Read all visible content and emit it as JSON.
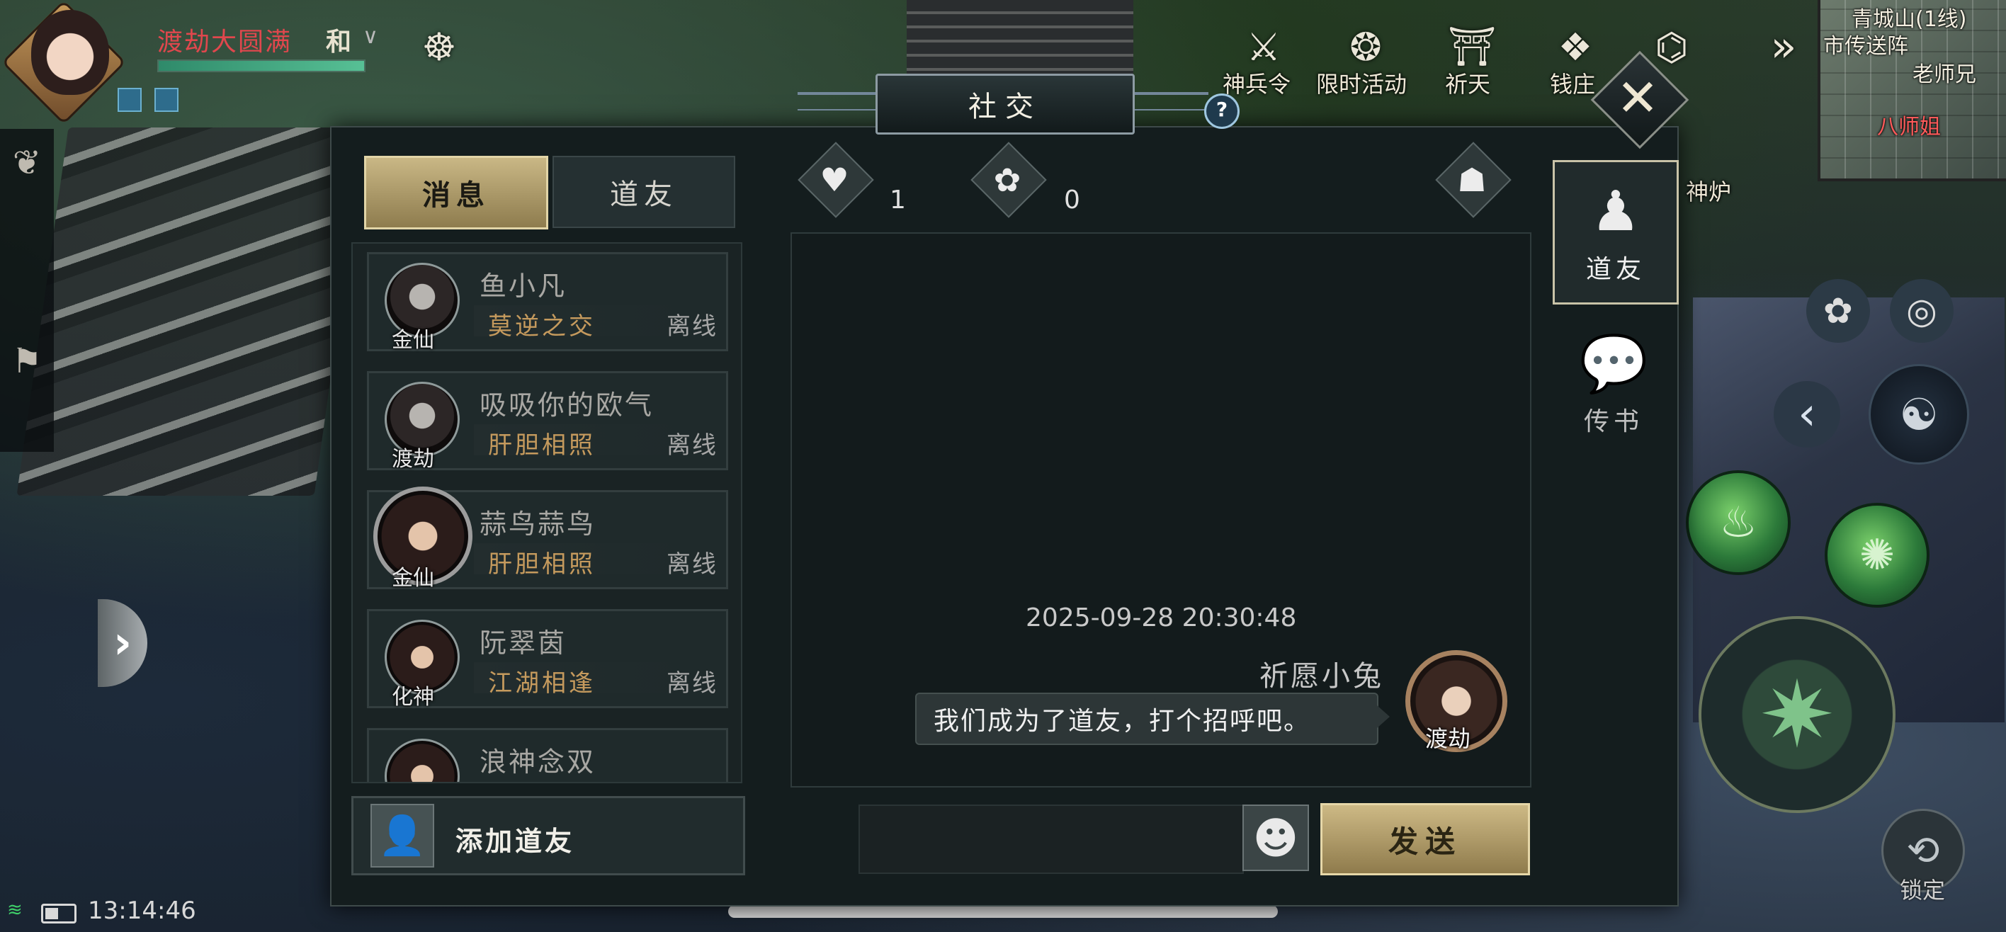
{
  "hud": {
    "player_name": "渡劫大圆满",
    "mode": "和",
    "hp_percent": 100,
    "feature_labels": [
      "神兵令",
      "限时活动",
      "祈天",
      "钱庄",
      "神炉"
    ],
    "minimap": {
      "region": "青城山(1线)",
      "place1": "市传送阵",
      "place2": "老师兄",
      "place3": "八师姐"
    },
    "clock": "13:14:46",
    "lock_label": "锁定"
  },
  "dialog": {
    "title": "社交",
    "help": "?",
    "close": "✕",
    "tabs": [
      {
        "label": "消息",
        "active": true
      },
      {
        "label": "道友",
        "active": false
      }
    ],
    "friends": [
      {
        "name": "鱼小凡",
        "relation": "莫逆之交",
        "status": "离线",
        "realm": "金仙"
      },
      {
        "name": "吸吸你的欧气",
        "relation": "肝胆相照",
        "status": "离线",
        "realm": "渡劫"
      },
      {
        "name": "蒜鸟蒜鸟",
        "relation": "肝胆相照",
        "status": "离线",
        "realm": "金仙"
      },
      {
        "name": "阮翠茵",
        "relation": "江湖相逢",
        "status": "离线",
        "realm": "化神"
      },
      {
        "name": "浪神念双",
        "relation": "",
        "status": "",
        "realm": ""
      }
    ],
    "add_friend_label": "添加道友",
    "stats": {
      "likes": "1",
      "flowers": "0"
    },
    "chat": {
      "timestamp": "2025-09-28 20:30:48",
      "sender": "祈愿小兔",
      "message": "我们成为了道友，打个招呼吧。",
      "sender_realm": "渡劫"
    },
    "send_label": "发送",
    "side_tabs": [
      {
        "label": "道友",
        "active": true
      },
      {
        "label": "传书",
        "active": false
      }
    ]
  },
  "colors": {
    "gold_button": "#c9b785",
    "relation_text": "#c59a5d",
    "player_name": "#e0474d",
    "panel_bg": "#141d1e"
  },
  "icons": [
    "heart-icon",
    "flower-icon",
    "mask-icon",
    "emoji-icon",
    "add-user-icon",
    "friend-figure-icon",
    "chat-bubble-icon"
  ]
}
